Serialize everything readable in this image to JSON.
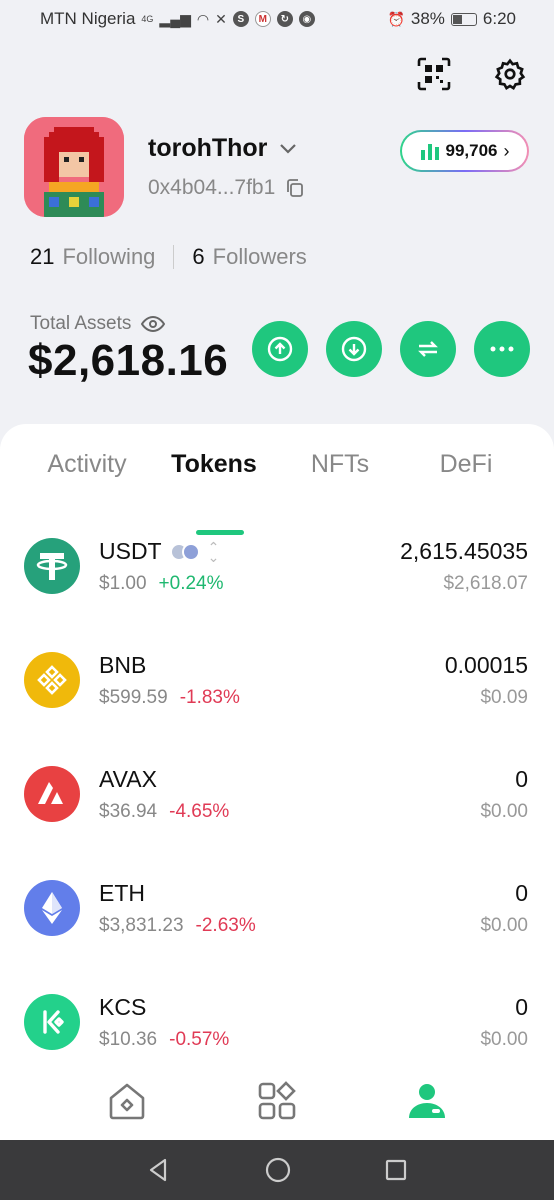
{
  "status_bar": {
    "carrier": "MTN Nigeria",
    "network": "4G",
    "battery": "38%",
    "time": "6:20"
  },
  "profile": {
    "username": "torohThor",
    "address": "0x4b04...7fb1",
    "points": "99,706",
    "following_count": "21",
    "following_label": "Following",
    "followers_count": "6",
    "followers_label": "Followers"
  },
  "assets": {
    "label": "Total Assets",
    "value": "$2,618.16"
  },
  "tabs": [
    {
      "label": "Activity",
      "active": false
    },
    {
      "label": "Tokens",
      "active": true
    },
    {
      "label": "NFTs",
      "active": false
    },
    {
      "label": "DeFi",
      "active": false
    }
  ],
  "tokens": [
    {
      "symbol": "USDT",
      "price": "$1.00",
      "change": "+0.24%",
      "direction": "up",
      "amount": "2,615.45035",
      "value": "$2,618.07",
      "icon": "tether-icon",
      "color": "#26a17b"
    },
    {
      "symbol": "BNB",
      "price": "$599.59",
      "change": "-1.83%",
      "direction": "down",
      "amount": "0.00015",
      "value": "$0.09",
      "icon": "bnb-icon",
      "color": "#f0b90b"
    },
    {
      "symbol": "AVAX",
      "price": "$36.94",
      "change": "-4.65%",
      "direction": "down",
      "amount": "0",
      "value": "$0.00",
      "icon": "avax-icon",
      "color": "#e84142"
    },
    {
      "symbol": "ETH",
      "price": "$3,831.23",
      "change": "-2.63%",
      "direction": "down",
      "amount": "0",
      "value": "$0.00",
      "icon": "eth-icon",
      "color": "#627eea"
    },
    {
      "symbol": "KCS",
      "price": "$10.36",
      "change": "-0.57%",
      "direction": "down",
      "amount": "0",
      "value": "$0.00",
      "icon": "kcs-icon",
      "color": "#23d18b"
    }
  ],
  "colors": {
    "accent": "#1fc77e",
    "up": "#1fb870",
    "down": "#e03a55"
  }
}
